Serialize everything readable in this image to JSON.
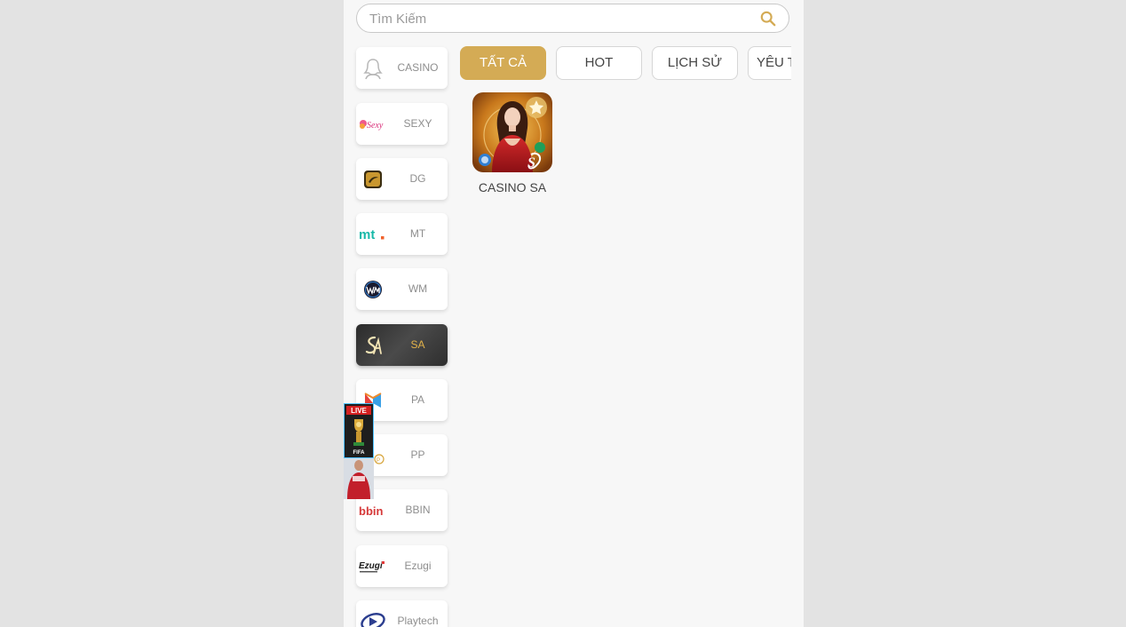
{
  "search": {
    "placeholder": "Tìm Kiếm",
    "icon": "search-icon"
  },
  "providers": [
    {
      "label": "CASINO",
      "icon": "casino-girl-icon"
    },
    {
      "label": "SEXY",
      "icon": "sexy-logo-icon"
    },
    {
      "label": "DG",
      "icon": "dg-logo-icon"
    },
    {
      "label": "MT",
      "icon": "mt-logo-icon"
    },
    {
      "label": "WM",
      "icon": "wm-logo-icon"
    },
    {
      "label": "SA",
      "icon": "sa-logo-icon",
      "active": true
    },
    {
      "label": "PA",
      "icon": "pa-logo-icon"
    },
    {
      "label": "PP",
      "icon": "pp-logo-icon"
    },
    {
      "label": "BBIN",
      "icon": "bbin-logo-icon"
    },
    {
      "label": "Ezugi",
      "icon": "ezugi-logo-icon"
    },
    {
      "label": "Playtech",
      "icon": "playtech-logo-icon"
    }
  ],
  "tabs": [
    {
      "label": "TẤT CẢ",
      "active": true
    },
    {
      "label": "HOT"
    },
    {
      "label": "LỊCH SỬ"
    },
    {
      "label": "YÊU THÍCH"
    }
  ],
  "games": [
    {
      "name": "CASINO SA",
      "favorite_icon": "star-icon"
    }
  ],
  "floating_banner": {
    "badge": "LIVE",
    "caption": "FIFA",
    "icon": "world-cup-trophy-icon"
  },
  "colors": {
    "accent": "#d4ab55",
    "active_label": "#e2b24a",
    "background": "#f7f7f7"
  }
}
